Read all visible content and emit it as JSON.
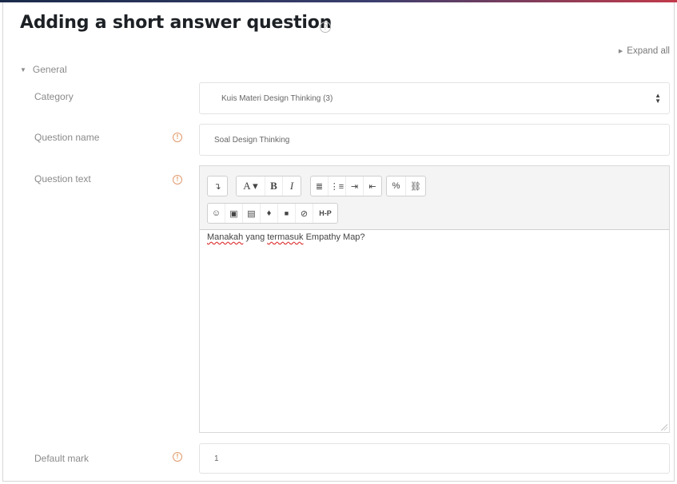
{
  "page": {
    "title": "Adding a short answer question",
    "help_icon": "question-circle-icon",
    "expand_all": "Expand all"
  },
  "section": {
    "title": "General"
  },
  "fields": {
    "category": {
      "label": "Category",
      "selected": "Kuis Materi Design Thinking (3)"
    },
    "question_name": {
      "label": "Question name",
      "required_icon": "exclamation-circle-icon",
      "value": "Soal Design Thinking"
    },
    "question_text": {
      "label": "Question text",
      "required_icon": "exclamation-circle-icon",
      "content": {
        "word1": "Manakah",
        "word2": "yang",
        "word3": "termasuk",
        "rest": "Empathy Map?"
      }
    },
    "default_mark": {
      "label": "Default mark",
      "required_icon": "exclamation-circle-icon",
      "value": "1"
    }
  },
  "toolbar": {
    "row1": [
      {
        "name": "collapse-toolbar-button",
        "glyph": "↴"
      },
      {
        "name": "font-style-button",
        "glyph": "A ▾"
      },
      {
        "name": "bold-button",
        "glyph": "B"
      },
      {
        "name": "italic-button",
        "glyph": "I"
      },
      {
        "name": "unordered-list-button",
        "glyph": "≣"
      },
      {
        "name": "ordered-list-button",
        "glyph": "⋮≡"
      },
      {
        "name": "indent-button",
        "glyph": "⇥"
      },
      {
        "name": "outdent-button",
        "glyph": "⇤"
      },
      {
        "name": "link-button",
        "glyph": "%"
      },
      {
        "name": "unlink-button",
        "glyph": "⛓"
      }
    ],
    "row2": [
      {
        "name": "emoticon-button",
        "glyph": "☺"
      },
      {
        "name": "image-button",
        "glyph": "▣"
      },
      {
        "name": "media-button",
        "glyph": "▤"
      },
      {
        "name": "record-audio-button",
        "glyph": "♦"
      },
      {
        "name": "record-video-button",
        "glyph": "■"
      },
      {
        "name": "manage-files-button",
        "glyph": "⊘"
      },
      {
        "name": "h5p-button",
        "glyph": "H-P"
      }
    ]
  },
  "colors": {
    "title": "#1d2125",
    "label": "#8a8a8a",
    "required": "#e0904f",
    "toolbar_bg": "#f4f4f4",
    "spell_underline": "#dd3333"
  }
}
